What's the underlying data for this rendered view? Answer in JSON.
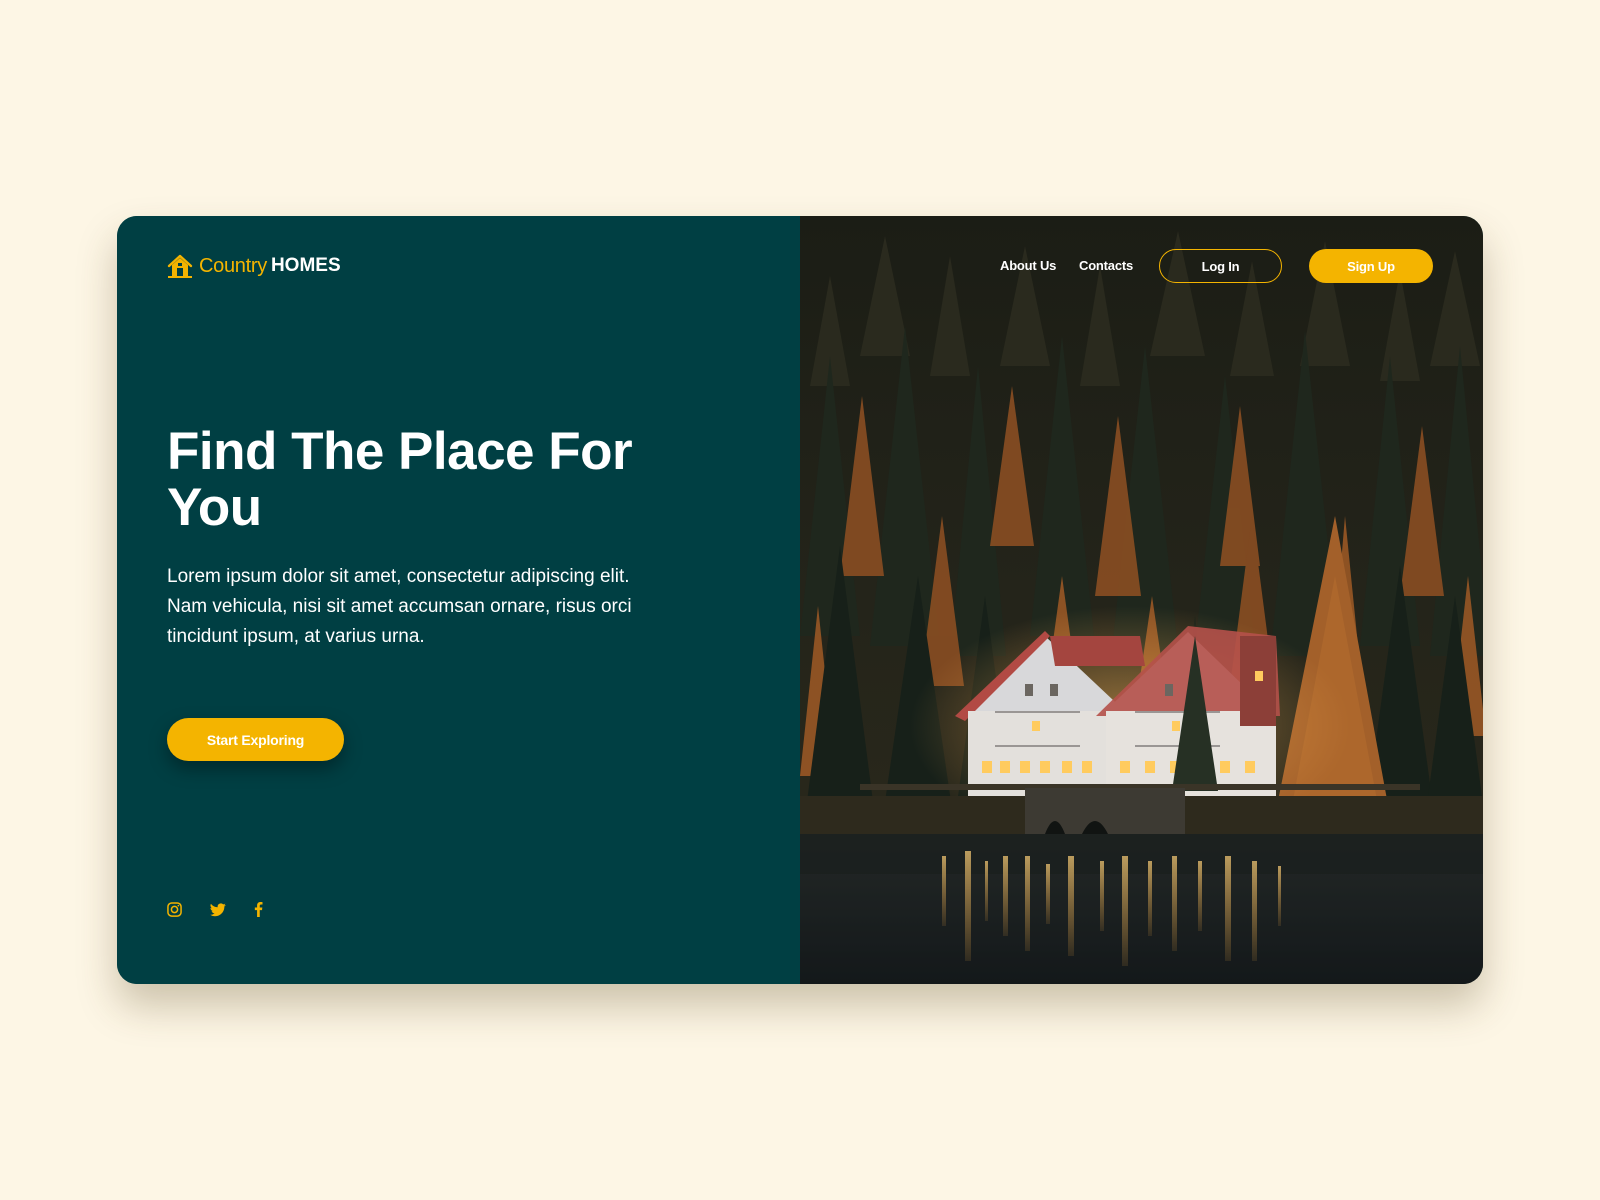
{
  "brand": {
    "name_light": "Country",
    "name_bold": "HOMES",
    "icon": "house-icon",
    "accent_color": "#f4b400",
    "panel_color": "#003f43",
    "page_background": "#fdf6e5"
  },
  "nav": {
    "links": [
      {
        "label": "About Us"
      },
      {
        "label": "Contacts"
      }
    ],
    "login_label": "Log In",
    "signup_label": "Sign Up"
  },
  "hero": {
    "headline": "Find The Place For You",
    "description": "Lorem ipsum dolor sit amet, consectetur adipiscing elit. Nam vehicula, nisi sit amet accumsan ornare, risus orci tincidunt ipsum, at varius urna.",
    "cta_label": "Start Exploring",
    "image": "house-by-lake-in-autumn-forest-photo"
  },
  "social": {
    "icons": [
      "instagram-icon",
      "twitter-icon",
      "facebook-icon"
    ]
  }
}
